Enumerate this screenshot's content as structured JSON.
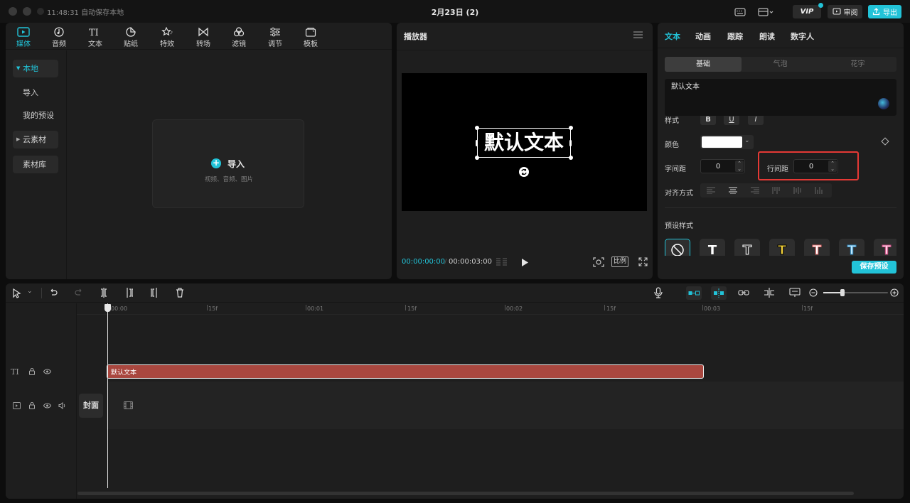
{
  "titlebar": {
    "time_status": "11:48:31 自动保存本地",
    "project_title": "2月23日 (2)",
    "vip_label": "VIP",
    "review_label": "审阅",
    "export_label": "导出",
    "icons": [
      "keyboard-icon",
      "layout-icon"
    ]
  },
  "media_toolbar": {
    "items": [
      {
        "label": "媒体",
        "icon": "media-icon",
        "active": true
      },
      {
        "label": "音频",
        "icon": "audio-icon"
      },
      {
        "label": "文本",
        "icon": "text-icon"
      },
      {
        "label": "贴纸",
        "icon": "sticker-icon"
      },
      {
        "label": "特效",
        "icon": "effects-icon"
      },
      {
        "label": "转场",
        "icon": "transition-icon"
      },
      {
        "label": "滤镜",
        "icon": "filter-icon"
      },
      {
        "label": "调节",
        "icon": "adjust-icon"
      },
      {
        "label": "模板",
        "icon": "template-icon"
      }
    ]
  },
  "media_sidebar": {
    "items": [
      {
        "label": "本地"
      },
      {
        "label": "导入"
      },
      {
        "label": "我的预设"
      },
      {
        "label": "云素材"
      },
      {
        "label": "素材库"
      }
    ]
  },
  "import": {
    "label": "导入",
    "hint": "视频、音频、图片"
  },
  "player": {
    "title": "播放器",
    "canvas_text": "默认文本",
    "current_time": "00:00:00:00",
    "total_time": "00:00:03:00",
    "ratio_label": "比例"
  },
  "inspector": {
    "tabs": [
      "文本",
      "动画",
      "跟踪",
      "朗读",
      "数字人"
    ],
    "subtabs": [
      "基础",
      "气泡",
      "花字"
    ],
    "text_value": "默认文本",
    "style_label": "样式",
    "style_buttons": [
      "B",
      "U",
      "I"
    ],
    "color_label": "颜色",
    "color_value": "#ffffff",
    "char_spacing_label": "字间距",
    "char_spacing_value": "0",
    "line_spacing_label": "行间距",
    "line_spacing_value": "0",
    "align_label": "对齐方式",
    "preset_label": "预设样式",
    "presets": [
      {
        "glyph": "",
        "color": "#ffffff"
      },
      {
        "glyph": "T",
        "color": "#ffffff"
      },
      {
        "glyph": "T",
        "color": "#111111"
      },
      {
        "glyph": "T",
        "color": "#f5d33a"
      },
      {
        "glyph": "T",
        "color": "#ffffff"
      },
      {
        "glyph": "T",
        "color": "#bfe9ff"
      },
      {
        "glyph": "T",
        "color": "#ffd1e6"
      }
    ],
    "save_preset_label": "保存预设",
    "accent_color": "#22c3d8",
    "highlight_color": "#e53935"
  },
  "timeline": {
    "ruler": [
      "00:00",
      "15f",
      "00:01",
      "15f",
      "00:02",
      "15f",
      "00:03",
      "15f"
    ],
    "text_clip_label": "默认文本",
    "text_clip_color": "#a9473f",
    "cover_label": "封面"
  }
}
